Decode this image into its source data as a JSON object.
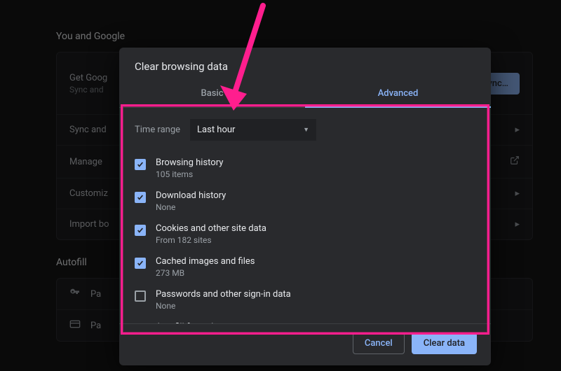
{
  "background": {
    "section1_title": "You and Google",
    "card": {
      "row1": {
        "title": "Get Goog",
        "sub": "Sync and"
      },
      "sync_button": "on sync…"
    },
    "rows": [
      {
        "label": "Sync and"
      },
      {
        "label": "Manage"
      },
      {
        "label": "Customiz"
      },
      {
        "label": "Import bo"
      }
    ],
    "section2_title": "Autofill",
    "autofill_rows": [
      {
        "label": "Pa"
      },
      {
        "label": "Pa"
      }
    ]
  },
  "modal": {
    "title": "Clear browsing data",
    "tabs": {
      "basic": "Basic",
      "advanced": "Advanced",
      "active": "advanced"
    },
    "time_range": {
      "label": "Time range",
      "value": "Last hour"
    },
    "items": [
      {
        "label": "Browsing history",
        "sub": "105 items",
        "checked": true
      },
      {
        "label": "Download history",
        "sub": "None",
        "checked": true
      },
      {
        "label": "Cookies and other site data",
        "sub": "From 182 sites",
        "checked": true
      },
      {
        "label": "Cached images and files",
        "sub": "273 MB",
        "checked": true
      },
      {
        "label": "Passwords and other sign-in data",
        "sub": "None",
        "checked": false
      },
      {
        "label": "Autofill form data",
        "sub": "",
        "checked": false
      }
    ],
    "buttons": {
      "cancel": "Cancel",
      "confirm": "Clear data"
    }
  },
  "annotation": {
    "color": "#ff1e8e"
  }
}
